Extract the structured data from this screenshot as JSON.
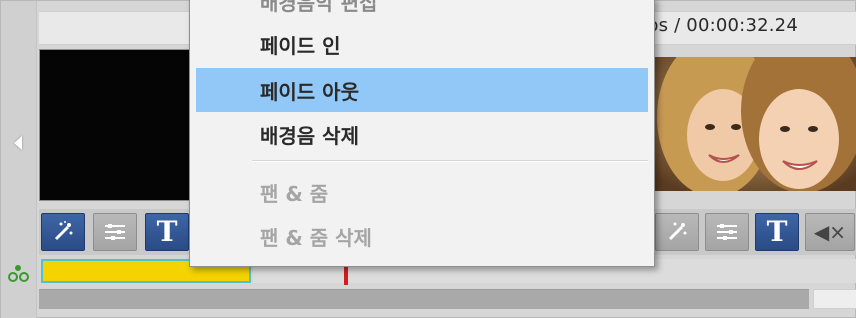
{
  "timeline": {
    "timecode": "ps / 00:00:32.24"
  },
  "context_menu": {
    "items": [
      {
        "label": "배경음악 편집",
        "state": "partially-hidden"
      },
      {
        "label": "페이드 인",
        "state": "enabled"
      },
      {
        "label": "페이드 아웃",
        "state": "highlighted"
      },
      {
        "label": "배경음 삭제",
        "state": "enabled"
      },
      {
        "label": "팬 & 줌",
        "state": "disabled"
      },
      {
        "label": "팬 & 줌 삭제",
        "state": "disabled"
      }
    ]
  },
  "toolbar_left": {
    "tools": [
      {
        "icon": "magic-wand-icon",
        "style": "blue"
      },
      {
        "icon": "sliders-icon",
        "style": "gray"
      },
      {
        "icon": "text-icon",
        "style": "blue",
        "glyph": "T"
      }
    ]
  },
  "toolbar_right": {
    "tools": [
      {
        "icon": "magic-wand-icon",
        "style": "gray"
      },
      {
        "icon": "sliders-icon",
        "style": "gray"
      },
      {
        "icon": "text-icon",
        "style": "blue",
        "glyph": "T"
      },
      {
        "icon": "mute-icon",
        "style": "gray",
        "glyph": "◀×"
      }
    ]
  },
  "colors": {
    "highlight": "#91c8f7",
    "audio_bar": "#f4d300",
    "audio_bar_border": "#4fc3c8",
    "playhead": "#d21e1e",
    "tool_blue": "#2a4b86"
  },
  "icons": {
    "nav": "chevron-left-icon",
    "track": "audio-track-icon"
  }
}
